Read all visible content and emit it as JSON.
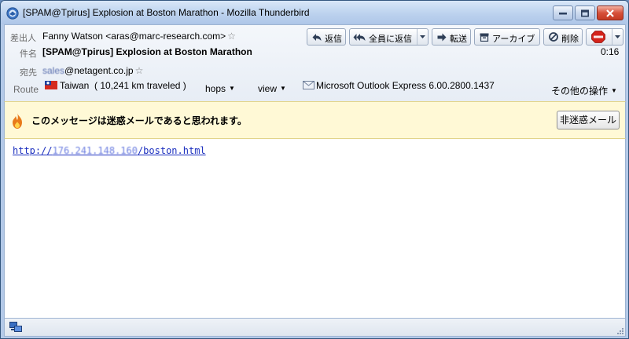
{
  "window": {
    "title": "[SPAM@Tpirus] Explosion at Boston Marathon - Mozilla Thunderbird"
  },
  "header": {
    "from_label": "差出人",
    "from_value": "Fanny Watson <aras@marc-research.com>",
    "subject_label": "件名",
    "subject_value": "[SPAM@Tpirus] Explosion at Boston Marathon",
    "to_label": "宛先",
    "to_value_obscured": "sales",
    "to_value_domain": "@netagent.co.jp",
    "time": "0:16",
    "route_label": "Route",
    "route_country": "Taiwan",
    "route_distance": "( 10,241 km traveled )",
    "hops_label": "hops",
    "view_label": "view",
    "mailer": "Microsoft Outlook Express 6.00.2800.1437",
    "other_actions": "その他の操作"
  },
  "toolbar": {
    "reply": "返信",
    "reply_all": "全員に返信",
    "forward": "転送",
    "archive": "アーカイブ",
    "delete": "削除"
  },
  "spam_bar": {
    "message": "このメッセージは迷惑メールであると思われます。",
    "not_junk_button": "非迷惑メール"
  },
  "body": {
    "link_prefix": "http://",
    "link_ip": "176.241.148.160",
    "link_suffix": "/boston.html"
  },
  "colors": {
    "link": "#1b2fbf",
    "spam_bar_bg": "#fff9d6",
    "title_bar": "#bcd2ee"
  }
}
